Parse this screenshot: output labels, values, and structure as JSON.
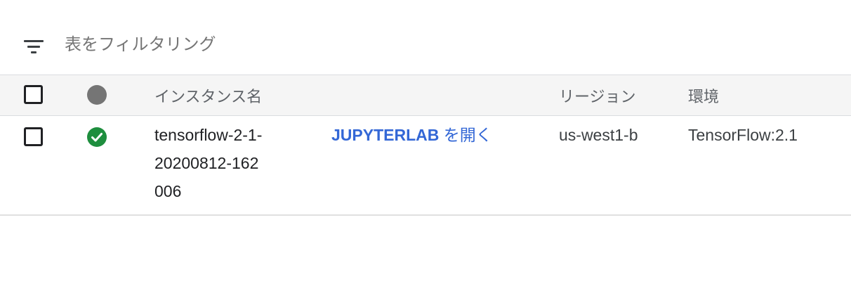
{
  "filter": {
    "placeholder": "表をフィルタリング",
    "icon": "filter-list-icon"
  },
  "table": {
    "headers": {
      "status_icon": "status-circle-icon",
      "name": "インスタンス名",
      "link": "",
      "region": "リージョン",
      "environment": "環境"
    },
    "rows": [
      {
        "status": "running",
        "status_icon": "check-circle-icon",
        "status_color": "#1e8e3e",
        "name": "tensorflow-2-1-20200812-162006",
        "link_label": "JUPYTERLAB",
        "link_suffix": "を開く",
        "region": "us-west1-b",
        "environment": "TensorFlow:2.1"
      }
    ]
  },
  "colors": {
    "link": "#3367d6",
    "header_bg": "#f5f5f5",
    "status_ok": "#1e8e3e",
    "status_header": "#757575"
  }
}
